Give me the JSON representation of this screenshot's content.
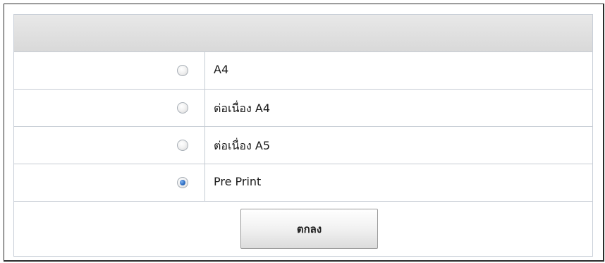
{
  "options": [
    {
      "label": "A4",
      "checked": false
    },
    {
      "label": "ต่อเนื่อง A4",
      "checked": false
    },
    {
      "label": "ต่อเนื่อง A5",
      "checked": false
    },
    {
      "label": "Pre Print",
      "checked": true
    }
  ],
  "buttons": {
    "ok_label": "ตกลง"
  },
  "colors": {
    "border": "#2b2b2b",
    "grid_line": "#c6ccd4",
    "header_bg": "#dedede",
    "radio_selected": "#2f6fc4"
  }
}
